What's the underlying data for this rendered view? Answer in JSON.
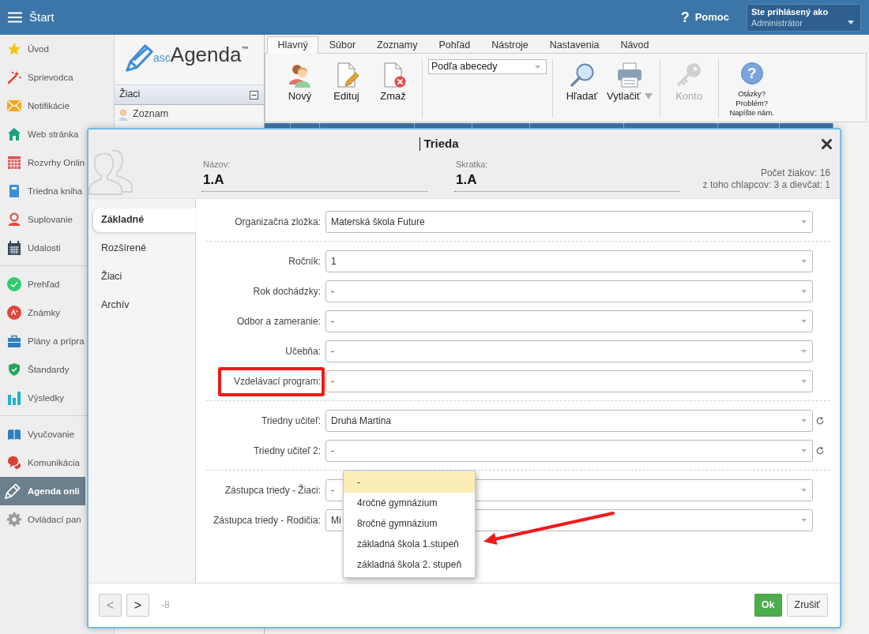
{
  "top_bar": {
    "title": "Štart",
    "help": {
      "symbol": "?",
      "label": "Pomoc"
    },
    "user": {
      "caption": "Ste prihlásený ako",
      "name": "Administrátor"
    }
  },
  "sidebar": {
    "groups": [
      [
        {
          "label": "Úvod",
          "selected": false
        },
        {
          "label": "Sprievodca",
          "selected": false
        },
        {
          "label": "Notifikácie",
          "selected": false
        },
        {
          "label": "Web stránka",
          "selected": false
        },
        {
          "label": "Rozvrhy Onlin",
          "selected": false
        },
        {
          "label": "Triedna kniha",
          "selected": false
        },
        {
          "label": "Suplovanie",
          "selected": false
        },
        {
          "label": "Udalosti",
          "selected": false
        }
      ],
      [
        {
          "label": "Prehľad",
          "selected": false
        },
        {
          "label": "Známky",
          "selected": false
        },
        {
          "label": "Plány a prípra",
          "selected": false
        },
        {
          "label": "Štandardy",
          "selected": false
        },
        {
          "label": "Výsledky",
          "selected": false
        }
      ],
      [
        {
          "label": "Vyučovanie",
          "selected": false
        },
        {
          "label": "Komunikácia",
          "selected": false
        },
        {
          "label": "Agenda onli",
          "selected": true
        },
        {
          "label": "Ovládací pan",
          "selected": false
        }
      ]
    ]
  },
  "panel": {
    "logo": {
      "small": "asc",
      "large": "Agenda",
      "mark": "™"
    },
    "section": {
      "title": "Žiaci",
      "expanded": true,
      "items": [
        "Zoznam"
      ]
    }
  },
  "ribbon": {
    "tabs": [
      {
        "label": "Hlavný",
        "selected": true
      },
      {
        "label": "Súbor",
        "selected": false
      },
      {
        "label": "Zoznamy",
        "selected": false
      },
      {
        "label": "Pohľad",
        "selected": false
      },
      {
        "label": "Nástroje",
        "selected": false
      },
      {
        "label": "Nastavenia",
        "selected": false
      },
      {
        "label": "Návod",
        "selected": false
      }
    ],
    "groups": [
      {
        "kind": "buttons",
        "buttons": [
          {
            "label": "Nový",
            "disabled": false,
            "dropdown": false
          },
          {
            "label": "Edituj",
            "disabled": false,
            "dropdown": false
          },
          {
            "label": "Zmaž",
            "disabled": false,
            "dropdown": false
          }
        ]
      },
      {
        "kind": "select",
        "value": "Podľa abecedy"
      },
      {
        "kind": "buttons",
        "buttons": [
          {
            "label": "Hľadať",
            "disabled": false,
            "dropdown": false
          },
          {
            "label": "Vytlačiť",
            "disabled": false,
            "dropdown": true
          }
        ]
      },
      {
        "kind": "buttons",
        "buttons": [
          {
            "label": "Konto",
            "disabled": true,
            "dropdown": false
          }
        ]
      },
      {
        "kind": "note",
        "symbol": "?",
        "lines": [
          "Otázky?",
          "Problém?",
          "Napíšte nám."
        ]
      }
    ]
  },
  "dialog": {
    "title": "Trieda",
    "header": {
      "fields": [
        {
          "label": "Názov:",
          "value": "1.A"
        },
        {
          "label": "Skratka:",
          "value": "1.A"
        }
      ],
      "stats": [
        "Počet žiakov: 16",
        "z toho chlapcov: 3 a dievčat: 1"
      ]
    },
    "tabs": [
      {
        "label": "Základné",
        "selected": true
      },
      {
        "label": "Rozšírené",
        "selected": false
      },
      {
        "label": "Žiaci",
        "selected": false
      },
      {
        "label": "Archív",
        "selected": false
      }
    ],
    "sections": [
      [
        {
          "label": "Organizačná zložka:",
          "value": "Materská škola Future",
          "kind": "select",
          "highlighted": false
        }
      ],
      [
        {
          "label": "Ročník:",
          "value": "1",
          "kind": "select",
          "highlighted": false
        },
        {
          "label": "Rok dochádzky:",
          "value": "-",
          "kind": "select",
          "highlighted": false
        },
        {
          "label": "Odbor a zameranie:",
          "value": "-",
          "kind": "select",
          "highlighted": false
        },
        {
          "label": "Učebňa:",
          "value": "-",
          "kind": "select",
          "highlighted": false
        },
        {
          "label": "Vzdelávací program:",
          "value": "-",
          "kind": "select",
          "highlighted": true
        }
      ],
      [
        {
          "label": "Triedny učiteľ:",
          "value": "Druhá Martina",
          "kind": "reloadable",
          "highlighted": false
        },
        {
          "label": "Triedny učiteľ 2:",
          "value": "-",
          "kind": "reloadable",
          "highlighted": false
        }
      ],
      [
        {
          "label": "Zástupca triedy - Žiaci:",
          "value": "-",
          "kind": "select",
          "highlighted": false
        },
        {
          "label": "Zástupca triedy - Rodičia:",
          "value": "Mi",
          "kind": "select",
          "highlighted": false
        }
      ]
    ],
    "footer": {
      "prev": {
        "label": "<",
        "disabled": true
      },
      "next": {
        "label": ">",
        "disabled": false
      },
      "counter": "-8",
      "ok": "Ok",
      "cancel": "Zrušiť"
    }
  },
  "dropdown": {
    "options": [
      {
        "label": "-",
        "selected": true
      },
      {
        "label": "4ročné gymnázium",
        "selected": false
      },
      {
        "label": "8ročné gymnázium",
        "selected": false
      },
      {
        "label": "základná škola 1.stupeň",
        "selected": false
      },
      {
        "label": "základná škola 2. stupeň",
        "selected": false
      }
    ]
  }
}
